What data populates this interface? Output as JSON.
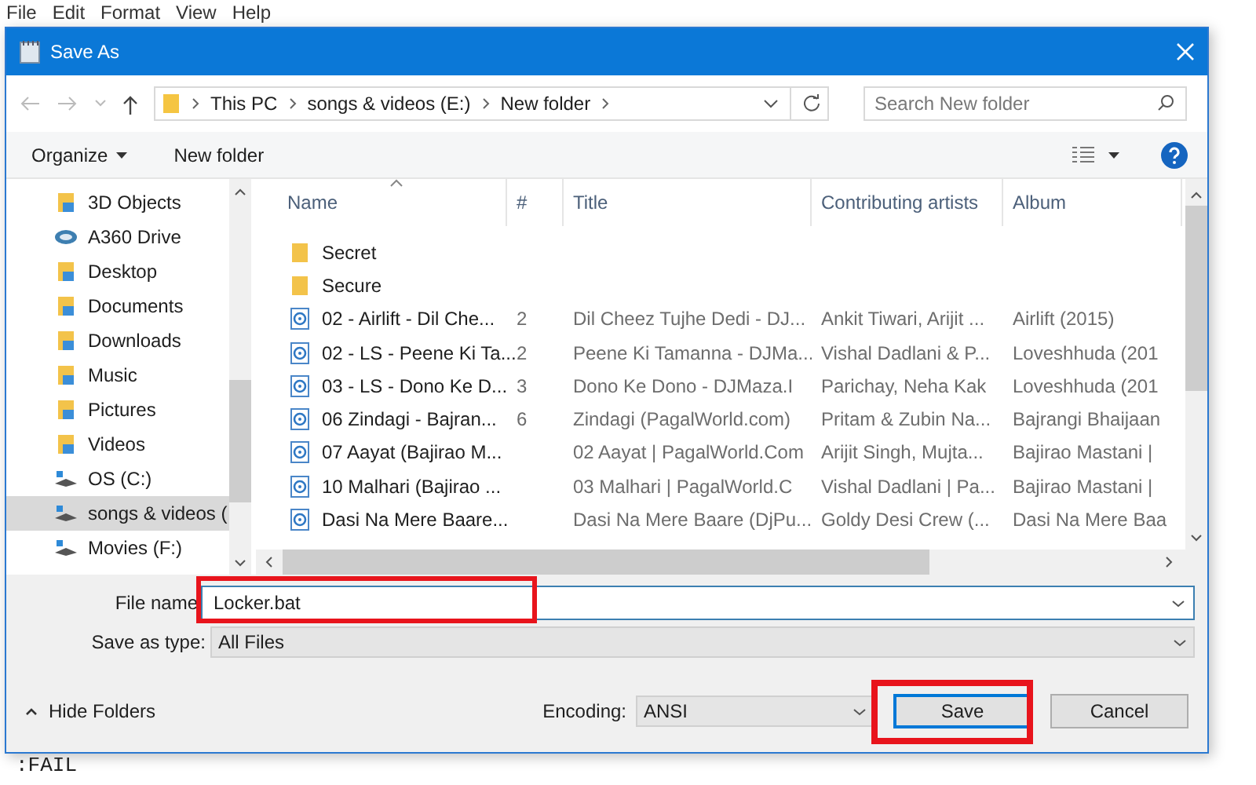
{
  "menu_bar": [
    "File",
    "Edit",
    "Format",
    "View",
    "Help"
  ],
  "window": {
    "title": "Save As"
  },
  "address_bar": {
    "path": [
      "This PC",
      "songs & videos (E:)",
      "New folder"
    ]
  },
  "search": {
    "placeholder": "Search New folder"
  },
  "toolbar": {
    "organize": "Organize",
    "new_folder": "New folder"
  },
  "navigation": [
    {
      "label": "3D Objects",
      "kind": "folder",
      "selected": false
    },
    {
      "label": "A360 Drive",
      "kind": "cloud",
      "selected": false
    },
    {
      "label": "Desktop",
      "kind": "folder",
      "selected": false
    },
    {
      "label": "Documents",
      "kind": "folder",
      "selected": false
    },
    {
      "label": "Downloads",
      "kind": "folder",
      "selected": false
    },
    {
      "label": "Music",
      "kind": "folder",
      "selected": false
    },
    {
      "label": "Pictures",
      "kind": "folder",
      "selected": false
    },
    {
      "label": "Videos",
      "kind": "folder",
      "selected": false
    },
    {
      "label": "OS (C:)",
      "kind": "drive",
      "selected": false
    },
    {
      "label": "songs & videos (",
      "kind": "drive",
      "selected": true
    },
    {
      "label": "Movies (F:)",
      "kind": "drive",
      "selected": false
    }
  ],
  "file_list": {
    "columns": [
      "Name",
      "#",
      "Title",
      "Contributing artists",
      "Album"
    ],
    "rows": [
      {
        "kind": "folder",
        "name": "Secret"
      },
      {
        "kind": "folder",
        "name": "Secure"
      },
      {
        "kind": "audio",
        "name": "02 - Airlift - Dil Che...",
        "number": "2",
        "title": "Dil Cheez Tujhe Dedi - DJ...",
        "artists": "Ankit Tiwari, Arijit ...",
        "album": "Airlift (2015)"
      },
      {
        "kind": "audio",
        "name": "02 - LS - Peene Ki Ta...",
        "number": "2",
        "title": "Peene Ki Tamanna - DJMa...",
        "artists": "Vishal Dadlani & P...",
        "album": "Loveshhuda (201"
      },
      {
        "kind": "audio",
        "name": "03 - LS - Dono Ke D...",
        "number": "3",
        "title": "Dono Ke Dono - DJMaza.I",
        "artists": "Parichay, Neha Kak",
        "album": "Loveshhuda (201"
      },
      {
        "kind": "audio",
        "name": "06 Zindagi - Bajran...",
        "number": "6",
        "title": "Zindagi (PagalWorld.com)",
        "artists": "Pritam & Zubin Na...",
        "album": "Bajrangi Bhaijaan"
      },
      {
        "kind": "audio",
        "name": "07 Aayat (Bajirao M...",
        "title": "02 Aayat | PagalWorld.Com",
        "artists": "Arijit Singh, Mujta...",
        "album": "Bajirao Mastani |"
      },
      {
        "kind": "audio",
        "name": "10 Malhari (Bajirao ...",
        "title": "03 Malhari | PagalWorld.C",
        "artists": "Vishal Dadlani | Pa...",
        "album": "Bajirao Mastani |"
      },
      {
        "kind": "audio",
        "name": "Dasi Na Mere Baare...",
        "title": "Dasi Na Mere Baare (DjPu...",
        "artists": "Goldy Desi Crew (...",
        "album": "Dasi Na Mere Baa"
      }
    ]
  },
  "file_name": {
    "label": "File name",
    "value": "Locker.bat"
  },
  "save_as_type": {
    "label": "Save as type:",
    "value": "All Files"
  },
  "hide_folders": "Hide Folders",
  "encoding": {
    "label": "Encoding:",
    "value": "ANSI"
  },
  "buttons": [
    {
      "label": "Save",
      "kind": "default"
    },
    {
      "label": "Cancel",
      "kind": "normal"
    }
  ],
  "console_text": ":FAIL"
}
